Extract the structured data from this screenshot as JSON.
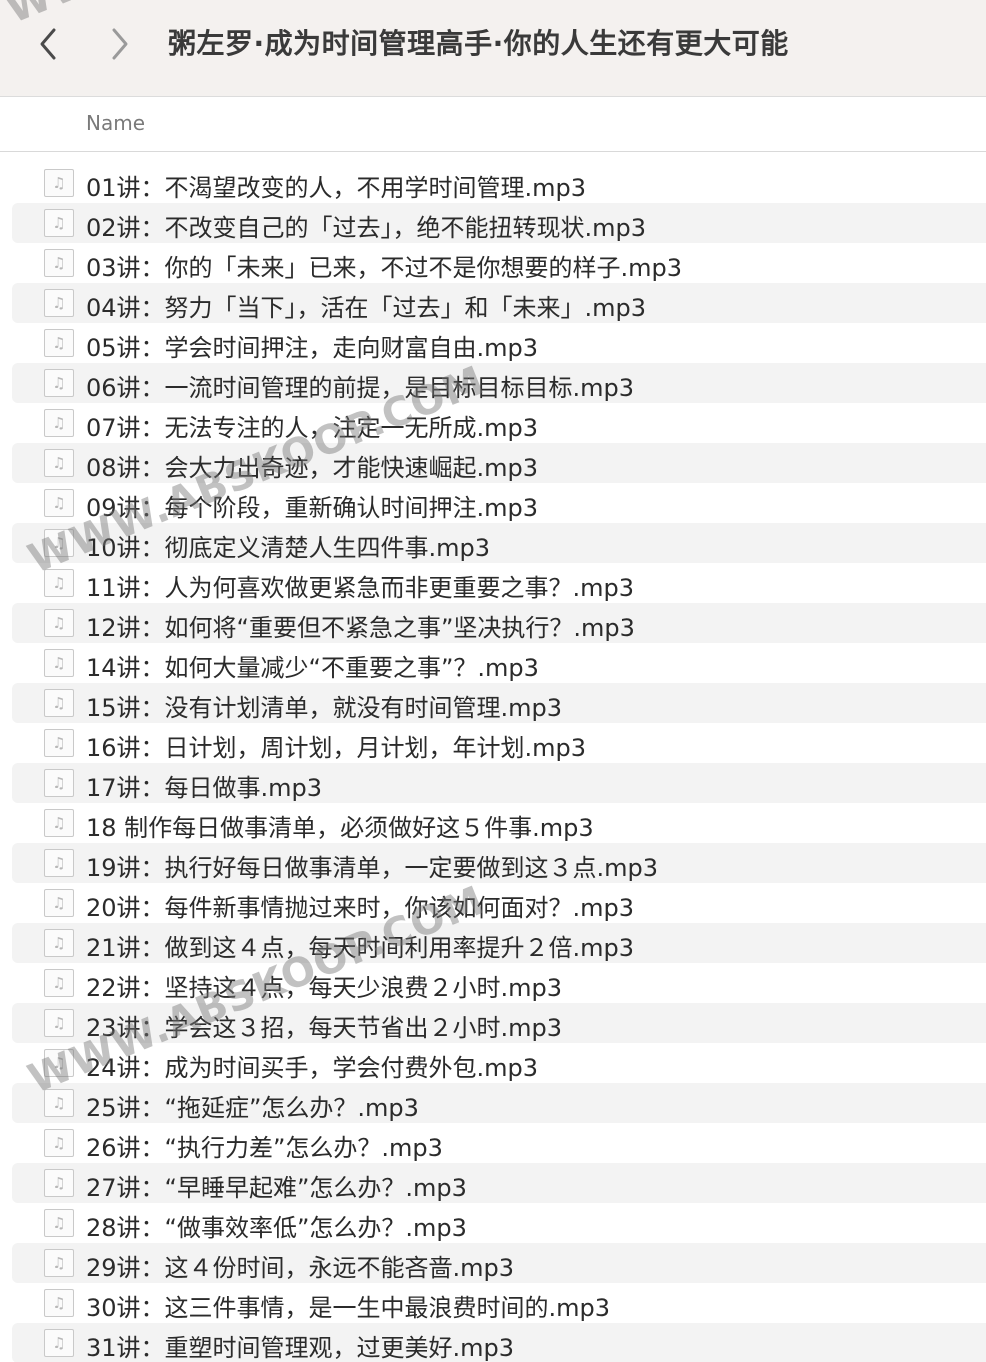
{
  "toolbar": {
    "back_icon": "chevron-left-icon",
    "forward_icon": "chevron-right-icon",
    "title": "粥左罗·成为时间管理高手·你的人生还有更大可能"
  },
  "header": {
    "name_column": "Name"
  },
  "files": [
    {
      "name": "01讲：不渴望改变的人，不用学时间管理.mp3"
    },
    {
      "name": "02讲：不改变自己的「过去」，绝不能扭转现状.mp3"
    },
    {
      "name": "03讲：你的「未来」已来，不过不是你想要的样子.mp3"
    },
    {
      "name": "04讲：努力「当下」，活在「过去」和「未来」.mp3"
    },
    {
      "name": "05讲：学会时间押注，走向财富自由.mp3"
    },
    {
      "name": "06讲：一流时间管理的前提，是目标目标目标.mp3"
    },
    {
      "name": "07讲：无法专注的人，注定一无所成.mp3"
    },
    {
      "name": "08讲：会大力出奇迹，才能快速崛起.mp3"
    },
    {
      "name": "09讲：每个阶段，重新确认时间押注.mp3"
    },
    {
      "name": "10讲：彻底定义清楚人生四件事.mp3"
    },
    {
      "name": "11讲：人为何喜欢做更紧急而非更重要之事？.mp3"
    },
    {
      "name": "12讲：如何将“重要但不紧急之事”坚决执行？.mp3"
    },
    {
      "name": "14讲：如何大量减少“不重要之事”？.mp3"
    },
    {
      "name": "15讲：没有计划清单，就没有时间管理.mp3"
    },
    {
      "name": "16讲：日计划，周计划，月计划，年计划.mp3"
    },
    {
      "name": "17讲：每日做事.mp3"
    },
    {
      "name": "18 制作每日做事清单，必须做好这５件事.mp3"
    },
    {
      "name": "19讲：执行好每日做事清单，一定要做到这３点.mp3"
    },
    {
      "name": "20讲：每件新事情抛过来时，你该如何面对？.mp3"
    },
    {
      "name": "21讲：做到这４点，每天时间利用率提升２倍.mp3"
    },
    {
      "name": "22讲：坚持这４点，每天少浪费２小时.mp3"
    },
    {
      "name": "23讲：学会这３招，每天节省出２小时.mp3"
    },
    {
      "name": "24讲：成为时间买手，学会付费外包.mp3"
    },
    {
      "name": "25讲：“拖延症”怎么办？.mp3"
    },
    {
      "name": "26讲：“执行力差”怎么办？.mp3"
    },
    {
      "name": "27讲：“早睡早起难”怎么办？.mp3"
    },
    {
      "name": "28讲：“做事效率低”怎么办？.mp3"
    },
    {
      "name": "29讲：这４份时间，永远不能吝啬.mp3"
    },
    {
      "name": "30讲：这三件事情，是一生中最浪费时间的.mp3"
    },
    {
      "name": "31讲：重塑时间管理观，过更美好.mp3"
    }
  ],
  "file_icon": "audio-file-icon",
  "watermarks": [
    "WWW.ABSKOOP.COM",
    "WWW.ABSKOOP.COM",
    "WWW.ABSKOOP.COM"
  ]
}
